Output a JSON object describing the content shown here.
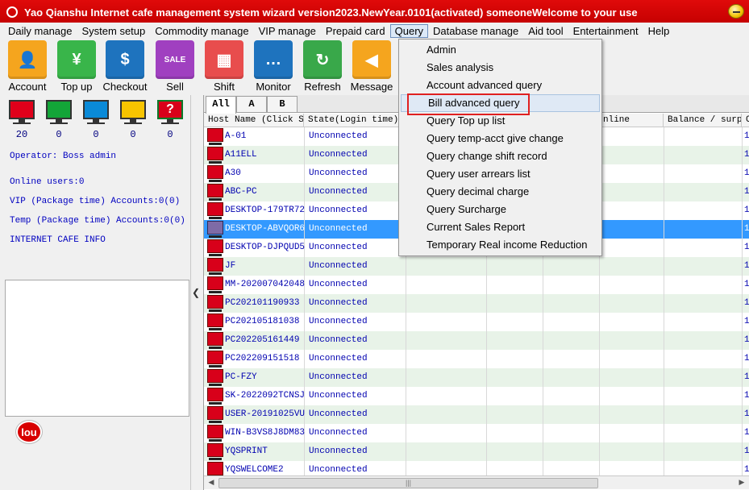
{
  "window": {
    "title": "Yao Qianshu Internet cafe management system wizard version2023.NewYear.0101(activated)  someoneWelcome to your use"
  },
  "menu": [
    "Daily manage",
    "System setup",
    "Commodity manage",
    "VIP manage",
    "Prepaid card",
    "Query",
    "Database manage",
    "Aid tool",
    "Entertainment",
    "Help"
  ],
  "menu_active": "Query",
  "toolbar": [
    {
      "label": "Account",
      "icon": "account-icon",
      "color": "#f5a51e",
      "glyph": "👤"
    },
    {
      "label": "Top up",
      "icon": "top-up-icon",
      "color": "#39b54a",
      "glyph": "¥"
    },
    {
      "label": "Checkout",
      "icon": "checkout-icon",
      "color": "#1e73be",
      "glyph": "$"
    },
    {
      "label": "Sell",
      "icon": "sell-icon",
      "color": "#a040c0",
      "glyph": "SALE"
    },
    {
      "label": "Shift",
      "icon": "shift-icon",
      "color": "#e84d4d",
      "glyph": "▦"
    },
    {
      "label": "Monitor",
      "icon": "monitor-icon",
      "color": "#1e73be",
      "glyph": "…"
    },
    {
      "label": "Refresh",
      "icon": "refresh-icon",
      "color": "#39a84a",
      "glyph": "↻"
    },
    {
      "label": "Message",
      "icon": "message-icon",
      "color": "#f5a51e",
      "glyph": "◀"
    }
  ],
  "status_monitors": [
    {
      "color": "#e0001a",
      "count": "20",
      "icon": "monitor-red-icon"
    },
    {
      "color": "#13a538",
      "count": "0",
      "icon": "monitor-green-icon"
    },
    {
      "color": "#0a8ad8",
      "count": "0",
      "icon": "monitor-blue-icon"
    },
    {
      "color": "#f7c400",
      "count": "0",
      "icon": "monitor-yellow-icon"
    },
    {
      "color": "#13a538",
      "count": "0",
      "icon": "monitor-question-icon",
      "glyph": "?"
    }
  ],
  "left_info": {
    "operator": "Operator: Boss admin",
    "online_users": "Online users:0",
    "vip_accounts": "VIP (Package time) Accounts:0(0)",
    "temp_accounts": "Temp (Package time) Accounts:0(0)",
    "cafe_info": "INTERNET CAFE  INFO"
  },
  "logo_text": "lou",
  "group_tabs": [
    "All",
    "A",
    "B"
  ],
  "columns": {
    "host": "Host Name (Click So",
    "state": "State(Login time)",
    "online": "nline",
    "balance": "Balance / surpl",
    "extra": "C"
  },
  "hosts": [
    {
      "name": "A-01",
      "state": "Unconnected"
    },
    {
      "name": "A11ELL",
      "state": "Unconnected"
    },
    {
      "name": "A30",
      "state": "Unconnected"
    },
    {
      "name": "ABC-PC",
      "state": "Unconnected"
    },
    {
      "name": "DESKTOP-179TR72",
      "state": "Unconnected"
    },
    {
      "name": "DESKTOP-ABVQOR6",
      "state": "Unconnected",
      "selected": true
    },
    {
      "name": "DESKTOP-DJPQUD5",
      "state": "Unconnected"
    },
    {
      "name": "JF",
      "state": "Unconnected"
    },
    {
      "name": "MM-202007042048",
      "state": "Unconnected"
    },
    {
      "name": "PC202101190933",
      "state": "Unconnected"
    },
    {
      "name": "PC202105181038",
      "state": "Unconnected"
    },
    {
      "name": "PC202205161449",
      "state": "Unconnected"
    },
    {
      "name": "PC202209151518",
      "state": "Unconnected"
    },
    {
      "name": "PC-FZY",
      "state": "Unconnected"
    },
    {
      "name": "SK-2022092TCNSJ",
      "state": "Unconnected"
    },
    {
      "name": "USER-20191025VU",
      "state": "Unconnected"
    },
    {
      "name": "WIN-B3VS8J8DM83",
      "state": "Unconnected"
    },
    {
      "name": "YQSPRINT",
      "state": "Unconnected"
    },
    {
      "name": "YQSWELCOME2",
      "state": "Unconnected"
    }
  ],
  "row_edge_value": "1",
  "query_menu": [
    "Admin",
    "Sales analysis",
    "Account advanced query",
    "Bill advanced query",
    "Query Top up list",
    "Query temp-acct give change",
    "Query change shift record",
    "Query user arrears list",
    "Query decimal charge",
    "Query Surcharge",
    "Current Sales Report",
    "Temporary Real income Reduction"
  ],
  "query_menu_hover": "Bill advanced query",
  "scroll_thumb_glyph": "|||"
}
